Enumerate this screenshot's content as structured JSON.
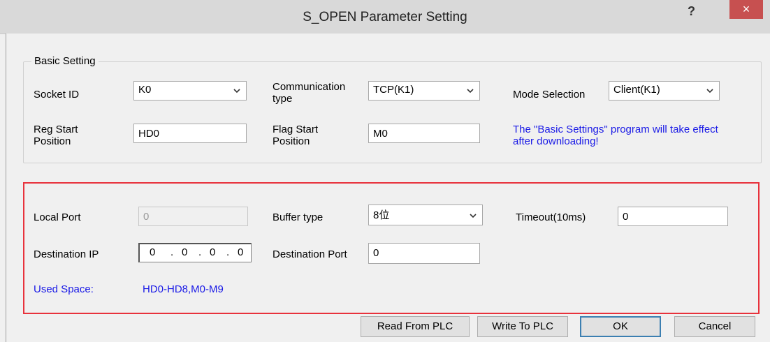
{
  "window": {
    "title": "S_OPEN Parameter Setting",
    "help": "?",
    "close": "×"
  },
  "basic": {
    "title": "Basic Setting",
    "socket_id_label": "Socket ID",
    "socket_id_value": "K0",
    "comm_type_label_1": "Communication",
    "comm_type_label_2": "type",
    "comm_type_value": "TCP(K1)",
    "mode_label": "Mode Selection",
    "mode_value": "Client(K1)",
    "reg_start_label_1": "Reg Start",
    "reg_start_label_2": "Position",
    "reg_start_value": "HD0",
    "flag_start_label_1": "Flag Start",
    "flag_start_label_2": "Position",
    "flag_start_value": "M0",
    "note_1": "The \"Basic Settings\" program will take effect",
    "note_2": "after downloading!"
  },
  "advanced": {
    "local_port_label": "Local Port",
    "local_port_value": "0",
    "buffer_type_label": "Buffer type",
    "buffer_type_value": "8位",
    "timeout_label": "Timeout(10ms)",
    "timeout_value": "0",
    "dest_ip_label": "Destination IP",
    "dest_ip_octets": [
      "0",
      "0",
      "0",
      "0"
    ],
    "dest_ip_dot": ".",
    "dest_port_label": "Destination Port",
    "dest_port_value": "0",
    "used_space_label": "Used Space:",
    "used_space_value": "HD0-HD8,M0-M9"
  },
  "buttons": {
    "read": "Read From PLC",
    "write": "Write To PLC",
    "ok": "OK",
    "cancel": "Cancel"
  },
  "colors": {
    "highlight_box": "#e8323c",
    "info_text": "#1a1ae6",
    "close_button": "#c75050"
  }
}
